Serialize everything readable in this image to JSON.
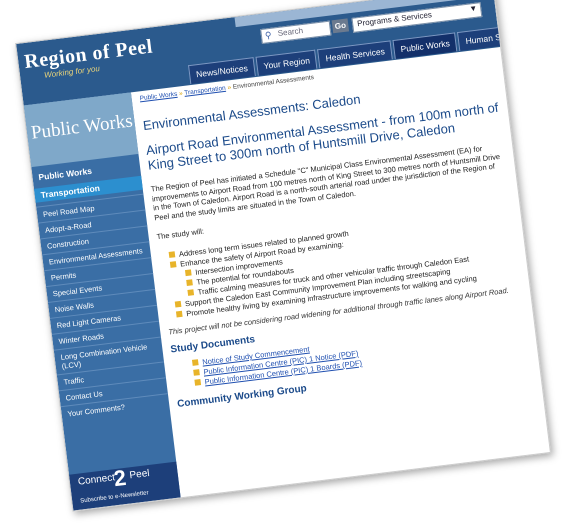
{
  "header": {
    "logo": "Region of Peel",
    "tagline": "Working for you",
    "search_placeholder": "Search",
    "go_label": "Go",
    "programs_select": "Programs & Services",
    "nav_tabs": [
      "News/Notices",
      "Your Region",
      "Health Services",
      "Public Works",
      "Human Services"
    ]
  },
  "sidebar": {
    "banner": "Public Works",
    "section": "Public Works",
    "active": "Transportation",
    "items": [
      "Peel Road Map",
      "Adopt-a-Road",
      "Construction",
      "Environmental Assessments",
      "Permits",
      "Special Events",
      "Noise Walls",
      "Red Light Cameras",
      "Winter Roads",
      "Long Combination Vehicle (LCV)",
      "Traffic",
      "Contact Us",
      "Your Comments?"
    ],
    "connect_left": "Connect",
    "connect_num": "2",
    "connect_right": "Peel",
    "connect_sub": "Subscribe to e-Newsletter"
  },
  "breadcrumb": {
    "items": [
      "Public Works",
      "Transportation",
      "Environmental Assessments"
    ]
  },
  "main": {
    "page_title": "Environmental Assessments: Caledon",
    "article_title": "Airport Road Environmental Assessment - from 100m north of King Street to 300m north of Huntsmill Drive, Caledon",
    "intro": "The Region of Peel has initiated a Schedule \"C\" Municipal Class Environmental Assessment (EA) for improvements to Airport Road from 100 metres north of King Street to 300 metres north of Huntsmill Drive in the Town of Caledon. Airport Road is a north-south arterial road under the jurisdiction of the Region of Peel and the study limits are situated in the Town of Caledon.",
    "study_lead": "The study will:",
    "study_items": {
      "item1": "Address long term issues related to planned growth",
      "item2": "Enhance the safety of Airport Road by examining:",
      "sub1": "Intersection improvements",
      "sub2": "The potential for roundabouts",
      "sub3": "Traffic calming measures for truck and other vehicular traffic through Caledon East",
      "item3": "Support the Caledon East Community Improvement Plan including streetscaping",
      "item4": "Promote healthy living by examining infrastructure improvements for walking and cycling"
    },
    "note": "This project will not be considering road widening for additional through traffic lanes along Airport Road.",
    "docs_heading": "Study Documents",
    "docs": [
      "Notice of Study Commencement",
      "Public Information Centre (PIC) 1 Notice (PDF)",
      "Public Information Centre (PIC) 1 Boards (PDF)"
    ],
    "cwg_heading": "Community Working Group"
  }
}
